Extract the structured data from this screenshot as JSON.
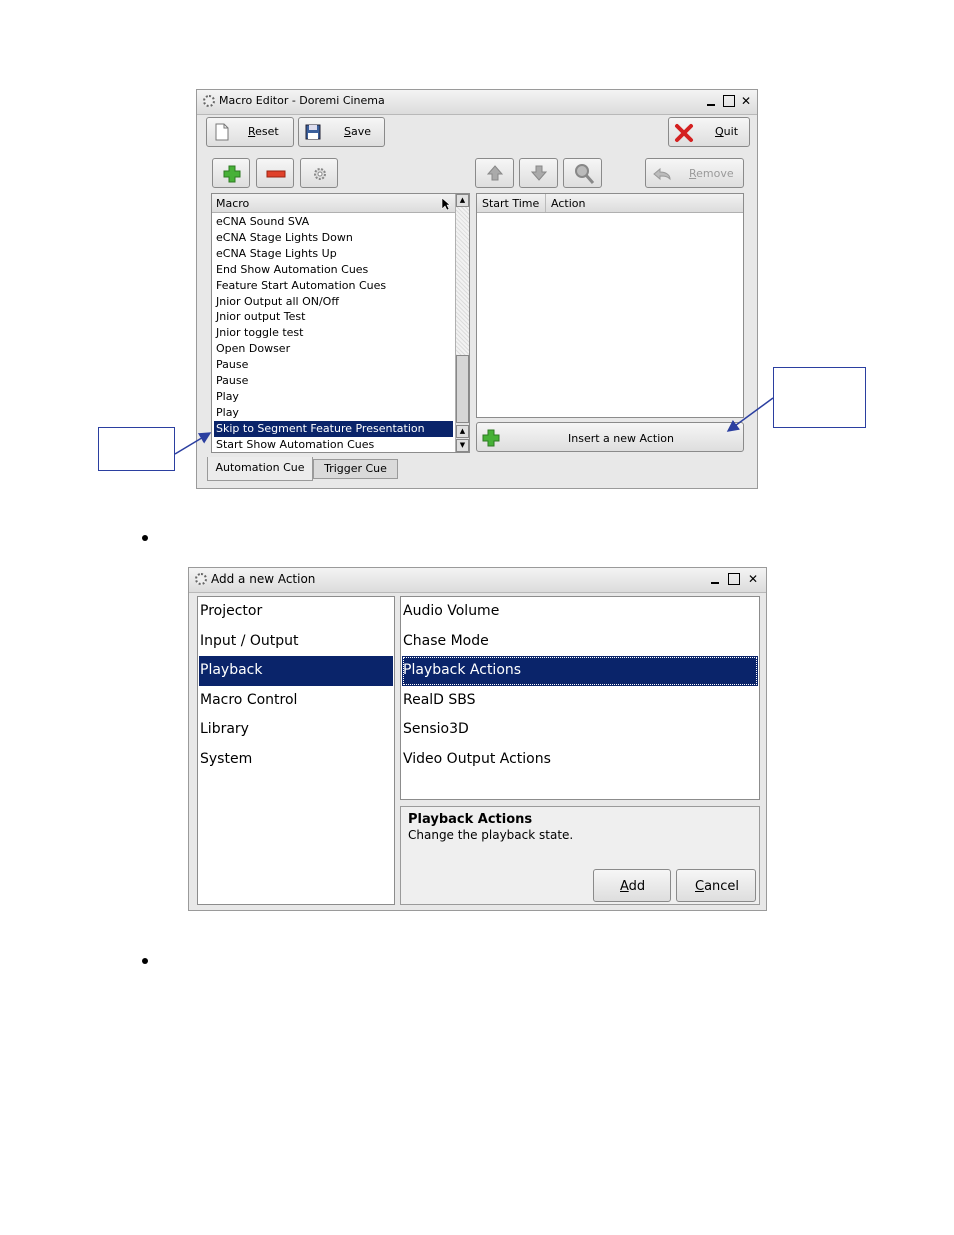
{
  "macro_editor": {
    "title": "Macro Editor - Doremi Cinema",
    "toolbar": {
      "reset_label": "Reset",
      "save_label": "Save",
      "quit_label": "Quit"
    },
    "actions_toolbar": {
      "remove_label": "Remove"
    },
    "macro_list": {
      "header": "Macro",
      "items": [
        "eCNA Sound SVA",
        "eCNA Stage Lights Down",
        "eCNA Stage Lights Up",
        "End Show Automation Cues",
        "Feature Start Automation Cues",
        "Jnior Output all ON/Off",
        "Jnior output Test",
        "Jnior toggle test",
        "Open Dowser",
        "Pause",
        "Pause",
        "Play",
        "Play",
        "Skip to Segment Feature Presentation",
        "Start Show Automation Cues"
      ],
      "selected_index": 13
    },
    "action_table": {
      "col_start_time": "Start Time",
      "col_action": "Action"
    },
    "insert_action_label": "Insert a new Action",
    "tabs": [
      "Automation Cue",
      "Trigger Cue"
    ],
    "active_tab": 0
  },
  "add_action_dialog": {
    "title": "Add a new Action",
    "categories": [
      "Projector",
      "Input / Output",
      "Playback",
      "Macro Control",
      "Library",
      "System"
    ],
    "selected_category": 2,
    "actions": [
      "Audio Volume",
      "Chase Mode",
      "Playback Actions",
      "RealD SBS",
      "Sensio3D",
      "Video Output Actions"
    ],
    "selected_action": 2,
    "description_title": "Playback Actions",
    "description_text": "Change the playback state.",
    "add_label": "Add",
    "cancel_label": "Cancel"
  },
  "colors": {
    "selection": "#0a246a",
    "callout_border": "#2b3fa0",
    "window_bg": "#e8e8e8"
  }
}
